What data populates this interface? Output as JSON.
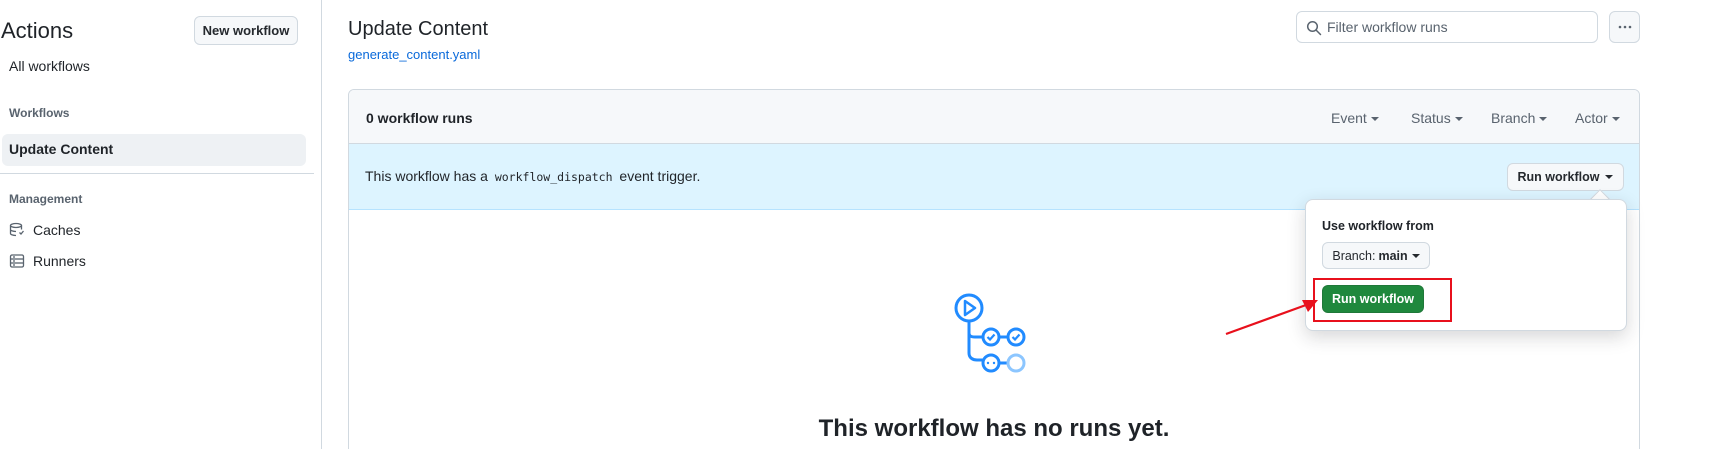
{
  "sidebar": {
    "title": "Actions",
    "new_workflow_label": "New workflow",
    "all_workflows_label": "All workflows",
    "workflows_heading": "Workflows",
    "active_workflow": "Update Content",
    "management_heading": "Management",
    "items": [
      {
        "label": "Caches",
        "icon": "database-icon"
      },
      {
        "label": "Runners",
        "icon": "server-icon"
      }
    ]
  },
  "header": {
    "title": "Update Content",
    "file_link": "generate_content.yaml",
    "filter_placeholder": "Filter workflow runs"
  },
  "runs": {
    "count_label": "0 workflow runs",
    "filters": [
      "Event",
      "Status",
      "Branch",
      "Actor"
    ]
  },
  "dispatch": {
    "text_before": "This workflow has a",
    "code": "workflow_dispatch",
    "text_after": "event trigger.",
    "run_workflow_label": "Run workflow"
  },
  "popover": {
    "label": "Use workflow from",
    "branch_prefix": "Branch:",
    "branch_value": "main",
    "run_button_label": "Run workflow"
  },
  "empty": {
    "message": "This workflow has no runs yet."
  },
  "colors": {
    "accent_blue": "#0969da",
    "primary_green": "#1f883d",
    "annotation_red": "#e8101c",
    "icon_blue": "#218bff"
  }
}
